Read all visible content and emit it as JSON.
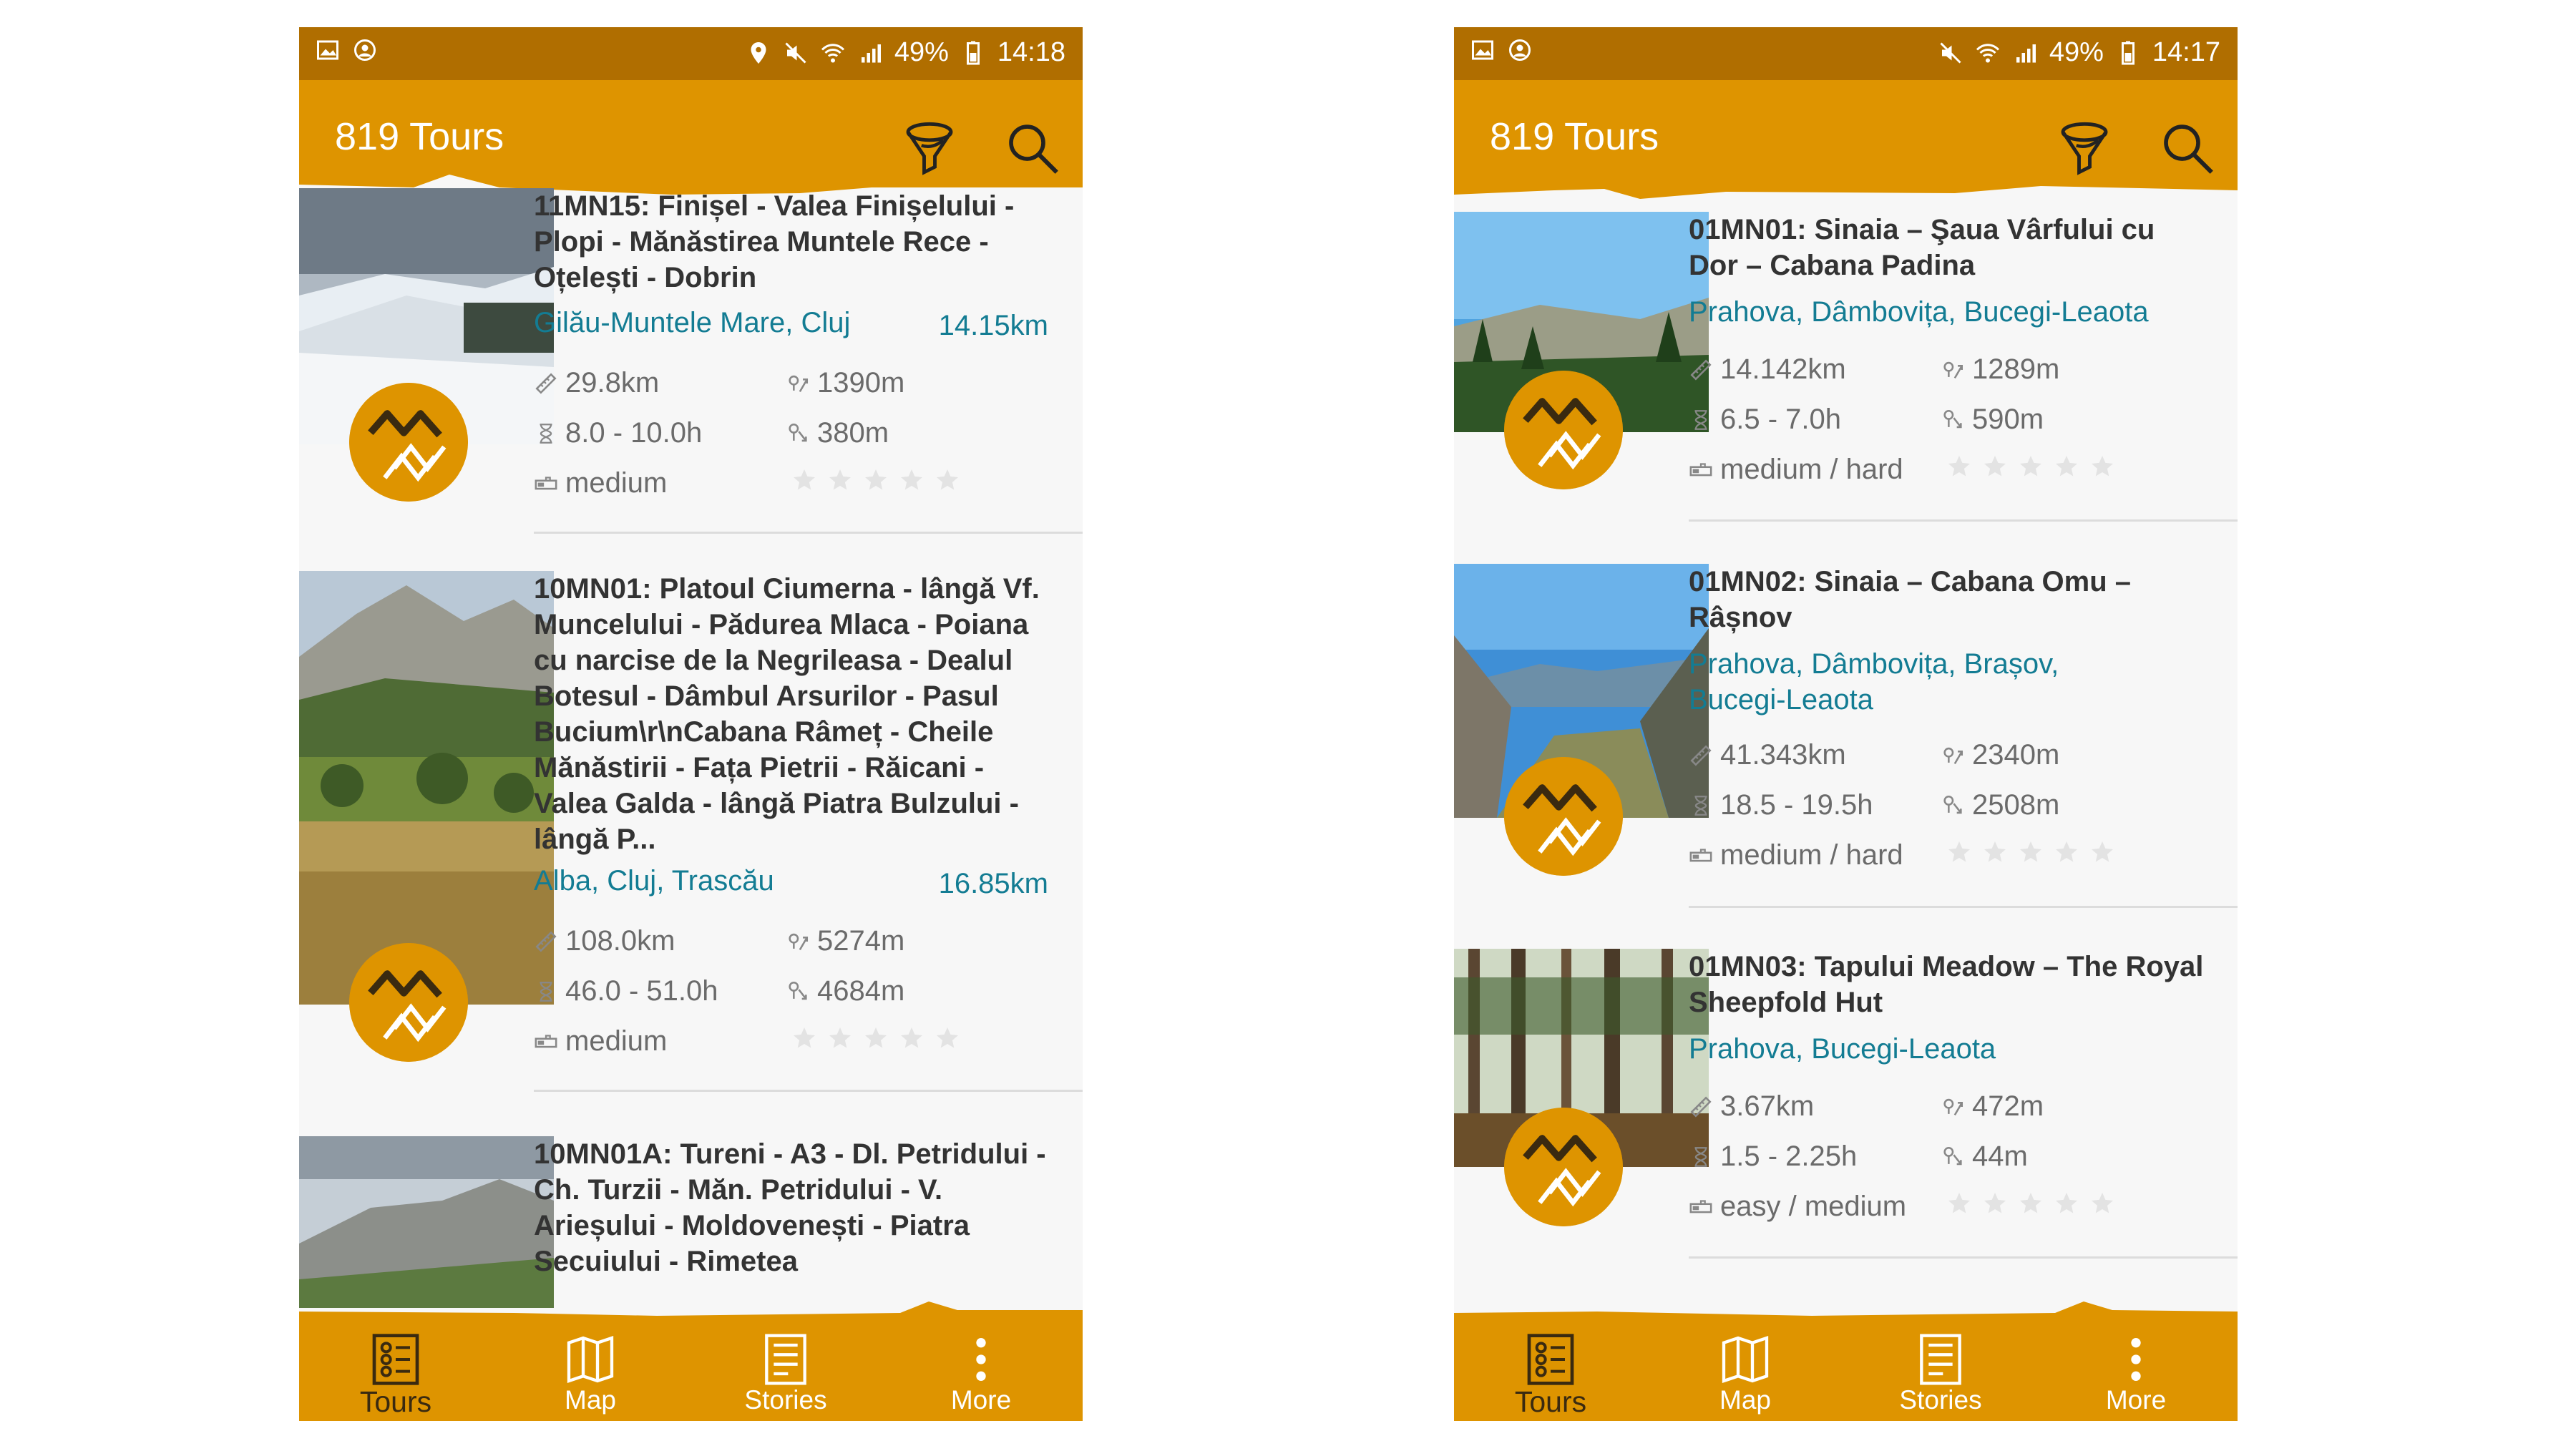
{
  "colors": {
    "accent": "#de9400",
    "status_bar": "#b06e00",
    "link": "#137c93",
    "text": "#333333",
    "muted": "#6b6b6b",
    "stars": "#e3e3e3"
  },
  "screens": [
    {
      "status": {
        "battery": "49%",
        "time": "14:18"
      },
      "header": {
        "title": "819 Tours",
        "filter_icon": "funnel-icon",
        "search_icon": "search-icon"
      },
      "tours": [
        {
          "title": "11MN15: Finișel - Valea Finișelului - Plopi - Mănăstirea Muntele Rece - Oțelești - Dobrin",
          "region": "Gilău-Muntele Mare, Cluj",
          "distance_from_you": "14.15km",
          "length": "29.8km",
          "ascent": "1390m",
          "duration": "8.0 - 10.0h",
          "descent": "380m",
          "difficulty": "medium",
          "rating": 0
        },
        {
          "title": "10MN01: Platoul Ciumerna - lângă Vf. Muncelului - Pădurea Mlaca - Poiana cu narcise de la Negrileasa - Dealul Botesul - Dâmbul Arsurilor - Pasul Bucium\\r\\nCabana Râmeț - Cheile Mănăstirii - Fața Pietrii - Răicani - Valea Galda - lângă Piatra Bulzului - lângă P...",
          "region": "Alba, Cluj, Trascău",
          "distance_from_you": "16.85km",
          "length": "108.0km",
          "ascent": "5274m",
          "duration": "46.0 - 51.0h",
          "descent": "4684m",
          "difficulty": "medium",
          "rating": 0
        },
        {
          "title": "10MN01A: Tureni - A3 - Dl. Petridului - Ch. Turzii - Măn. Petridului - V. Arieșului - Moldovenești - Piatra Secuiului - Rimetea"
        }
      ],
      "nav": [
        {
          "label": "Tours",
          "icon": "tours-list-icon"
        },
        {
          "label": "Map",
          "icon": "map-icon"
        },
        {
          "label": "Stories",
          "icon": "stories-icon"
        },
        {
          "label": "More",
          "icon": "more-vertical-icon"
        }
      ]
    },
    {
      "status": {
        "battery": "49%",
        "time": "14:17"
      },
      "header": {
        "title": "819 Tours",
        "filter_icon": "funnel-icon",
        "search_icon": "search-icon"
      },
      "tours": [
        {
          "title": "01MN01: Sinaia – Şaua Vârfului cu Dor – Cabana Padina",
          "region": "Prahova, Dâmbovița, Bucegi-Leaota",
          "length": "14.142km",
          "ascent": "1289m",
          "duration": "6.5 - 7.0h",
          "descent": "590m",
          "difficulty": "medium / hard",
          "rating": 0
        },
        {
          "title": "01MN02: Sinaia – Cabana Omu – Râșnov",
          "region": "Prahova, Dâmbovița, Brașov, Bucegi-Leaota",
          "length": "41.343km",
          "ascent": "2340m",
          "duration": "18.5 - 19.5h",
          "descent": "2508m",
          "difficulty": "medium / hard",
          "rating": 0
        },
        {
          "title": "01MN03: Tapului Meadow – The Royal Sheepfold Hut",
          "region": "Prahova, Bucegi-Leaota",
          "length": "3.67km",
          "ascent": "472m",
          "duration": "1.5 - 2.25h",
          "descent": "44m",
          "difficulty": "easy / medium",
          "rating": 0
        }
      ],
      "nav": [
        {
          "label": "Tours",
          "icon": "tours-list-icon"
        },
        {
          "label": "Map",
          "icon": "map-icon"
        },
        {
          "label": "Stories",
          "icon": "stories-icon"
        },
        {
          "label": "More",
          "icon": "more-vertical-icon"
        }
      ]
    }
  ]
}
